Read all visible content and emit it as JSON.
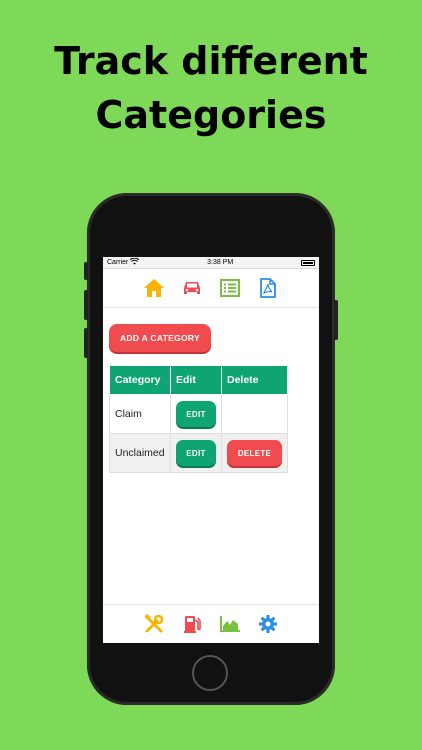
{
  "headline": {
    "line1": "Track different",
    "line2": "Categories"
  },
  "status_bar": {
    "carrier": "Carrier",
    "time": "3:38 PM"
  },
  "top_nav": [
    "home-icon",
    "car-icon",
    "list-icon",
    "pdf-icon"
  ],
  "add_button": {
    "label": "ADD A CATEGORY"
  },
  "table": {
    "headers": [
      "Category",
      "Edit",
      "Delete"
    ],
    "rows": [
      {
        "category": "Claim",
        "edit_label": "EDIT",
        "delete_label": ""
      },
      {
        "category": "Unclaimed",
        "edit_label": "EDIT",
        "delete_label": "DELETE"
      }
    ]
  },
  "bottom_nav": [
    "tools-icon",
    "fuel-icon",
    "chart-icon",
    "gear-icon"
  ],
  "colors": {
    "background": "#7dd957",
    "green": "#0fa573",
    "red": "#f04b4f",
    "yellow": "#f7b500",
    "blue": "#2a8ee8"
  }
}
